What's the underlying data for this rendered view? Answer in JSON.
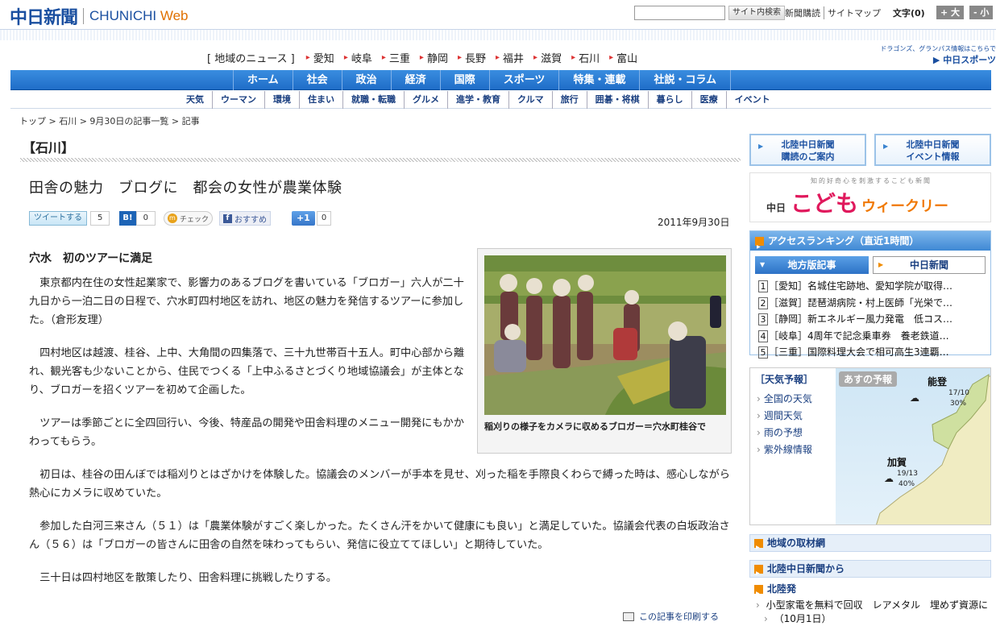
{
  "header": {
    "logo_kanji": "中日新聞",
    "logo_en_a": "CHUNICHI",
    "logo_en_b": " Web",
    "search_button": "サイト内検索",
    "links": [
      "新聞購読",
      "サイトマップ"
    ],
    "fontsize_label": "文字(0)",
    "bigger": "+ 大",
    "smaller": "- 小"
  },
  "region": {
    "label": "[ 地域のニュース ]",
    "items": [
      "愛知",
      "岐阜",
      "三重",
      "静岡",
      "長野",
      "福井",
      "滋賀",
      "石川",
      "富山"
    ]
  },
  "sports": {
    "small": "ドラゴンズ、グランパス情報はこちらで",
    "logo": "▶ 中日スポーツ"
  },
  "mainnav": [
    "ホーム",
    "社会",
    "政治",
    "経済",
    "国際",
    "スポーツ",
    "特集・連載",
    "社説・コラム"
  ],
  "subnav": [
    "天気",
    "ウーマン",
    "環境",
    "住まい",
    "就職・転職",
    "グルメ",
    "進学・教育",
    "クルマ",
    "旅行",
    "囲碁・将棋",
    "暮らし",
    "医療",
    "イベント"
  ],
  "breadcrumb": "トップ > 石川 > 9月30日の記事一覧 > 記事",
  "section_title": "【石川】",
  "article": {
    "title": "田舎の魅力　ブログに　都会の女性が農業体験",
    "date": "2011年9月30日",
    "subhead": "穴水　初のツアーに満足",
    "paragraphs": [
      "　東京都内在住の女性起業家で、影響力のあるブログを書いている「ブロガー」六人が二十九日から一泊二日の日程で、穴水町四村地区を訪れ、地区の魅力を発信するツアーに参加した。（倉形友理）",
      "　四村地区は越渡、桂谷、上中、大角間の四集落で、三十九世帯百十五人。町中心部から離れ、観光客も少ないことから、住民でつくる「上中ふるさとづくり地域協議会」が主体となり、ブロガーを招くツアーを初めて企画した。",
      "　ツアーは季節ごとに全四回行い、今後、特産品の開発や田舎料理のメニュー開発にもかかわってもらう。",
      "　初日は、桂谷の田んぼでは稲刈りとはざかけを体験した。協議会のメンバーが手本を見せ、刈った稲を手際良くわらで縛った時は、感心しながら熱心にカメラに収めていた。",
      "　参加した白河三来さん（５１）は「農業体験がすごく楽しかった。たくさん汗をかいて健康にも良い」と満足していた。協議会代表の白坂政治さん（５６）は「ブロガーの皆さんに田舎の自然を味わってもらい、発信に役立ててほしい」と期待していた。",
      "　三十日は四村地区を散策したり、田舎料理に挑戦したりする。"
    ],
    "photo_caption": "稲刈りの様子をカメラに収めるブロガー＝穴水町桂谷で",
    "print_label": "この記事を印刷する"
  },
  "social": {
    "tweet": "ツイートする",
    "tweet_count": "5",
    "hatena": "B!",
    "hatena_count": "0",
    "mixi": "チェック",
    "facebook": "おすすめ",
    "gplus": "+1",
    "gplus_count": "0"
  },
  "right": {
    "btn1": "北陸中日新聞\n購読のご案内",
    "btn1_a": "北陸中日新聞",
    "btn1_b": "購読のご案内",
    "btn2_a": "北陸中日新聞",
    "btn2_b": "イベント情報",
    "kodomo_tag": "知的好奇心を刺激するこども新聞",
    "kodomo_small": "中日",
    "kodomo_main": "こども",
    "kodomo_sub": "ウィークリー",
    "ranking_title": "アクセスランキング（直近1時間）",
    "ranking_tab_a": "地方版記事",
    "ranking_tab_b": "中日新聞",
    "ranking": [
      {
        "n": "1",
        "text": "［愛知］名城住宅跡地、愛知学院が取得…"
      },
      {
        "n": "2",
        "text": "［滋賀］琵琶湖病院・村上医師「光栄で…"
      },
      {
        "n": "3",
        "text": "［静岡］新エネルギー風力発電　低コス…"
      },
      {
        "n": "4",
        "text": "［岐阜］4周年で記念乗車券　養老鉄道…"
      },
      {
        "n": "5",
        "text": "［三重］国際料理大会で相可高生3連覇…"
      }
    ],
    "weather_title": "［天気予報］",
    "weather_links": [
      "全国の天気",
      "週間天気",
      "雨の予想",
      "紫外線情報"
    ],
    "weather_head": "あすの予報",
    "noto": "能登",
    "noto_temp": "17/10",
    "noto_pop": "30%",
    "kaga": "加賀",
    "kaga_temp": "19/13",
    "kaga_pop": "40%",
    "bar1": "地域の取材網",
    "bar2": "北陸中日新聞から",
    "bar3": "北陸発",
    "news1": "小型家電を無料で回収　レアメタル　埋めず資源に",
    "news1_date": "（10月1日）"
  }
}
